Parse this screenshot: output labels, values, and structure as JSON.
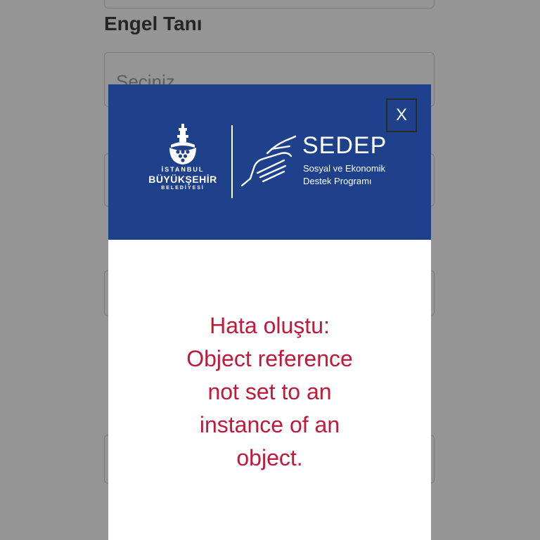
{
  "form": {
    "engel_label": "Engel Tanı",
    "engel_placeholder": "Seçiniz"
  },
  "modal": {
    "close_label": "X",
    "logo": {
      "line1": "İSTANBUL",
      "line2": "BÜYÜKŞEHİR",
      "line3": "BELEDİYESİ"
    },
    "brand": {
      "title": "SEDEP",
      "subtitle_line1": "Sosyal ve Ekonomik",
      "subtitle_line2": "Destek Programı"
    },
    "error_lines": [
      "Hata oluştu:",
      "Object reference",
      "not set to an",
      "instance of an",
      "object."
    ]
  },
  "colors": {
    "header_blue": "#1f418c",
    "error_red": "#c0193a"
  },
  "icons": {
    "logo": "ibb-tower-emblem",
    "brand": "helping-hands-icon"
  }
}
